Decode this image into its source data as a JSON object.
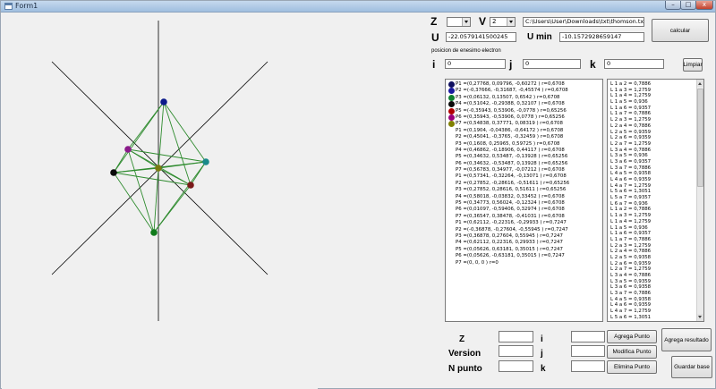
{
  "window": {
    "title": "Form1",
    "controls": {
      "minimize": "–",
      "maximize": "□",
      "close": "x"
    }
  },
  "controls": {
    "z_label": "Z",
    "z_value": "",
    "v_label": "V",
    "v_value": "2",
    "file_path": "C:\\Users\\User\\Downloads\\txt\\thomson.txt",
    "calcular_label": "calcular",
    "u_label": "U",
    "u_value": "-22.0579141500245",
    "umin_label": "U min",
    "umin_value": "-10.1572928659147",
    "posicion_label": "posicion de enesimo electron",
    "i_label": "i",
    "i_value": "0",
    "j_label": "j",
    "j_value": "0",
    "k_label": "k",
    "k_value": "0",
    "limpiar_label": "Limpiar"
  },
  "points": [
    {
      "text": "P1 =(0,27768, 0,09796, -0,60272 ) r=0,6708",
      "color": "#101060"
    },
    {
      "text": "P2 =(-0,37666, -0,31687, -0,45574 ) r=0,6708",
      "color": "#1a1aa0"
    },
    {
      "text": "P3 =(0,06132, 0,13507, 0,6542 ) r=0,6708",
      "color": "#0f8030"
    },
    {
      "text": "P4 =(0,51042, -0,29388, 0,32107 ) r=0,6708",
      "color": "#0a0a0a"
    },
    {
      "text": "P5 =(-0,35943, 0,53906, -0,0778 ) r=0,65256",
      "color": "#b00000"
    },
    {
      "text": "P6 =(0,35943, -0,53906, 0,0778 ) r=0,65256",
      "color": "#9a007a"
    },
    {
      "text": "P7 =(0,54838, 0,37771, 0,08319 ) r=0,6708",
      "color": "#808000"
    },
    {
      "text": "P1 =(0,1904, -0,04386, -0,64172 ) r=0,6708",
      "color": ""
    },
    {
      "text": "P2 =(0,45041, -0,3765, -0,32459 ) r=0,6708",
      "color": ""
    },
    {
      "text": "P3 =(0,1608, 0,25965, 0,59725 ) r=0,6708",
      "color": ""
    },
    {
      "text": "P4 =(0,46862, -0,18906, 0,44117 ) r=0,6708",
      "color": ""
    },
    {
      "text": "P5 =(0,34632, 0,53487, -0,13928 ) r=0,65256",
      "color": ""
    },
    {
      "text": "P6 =(0,34632, -0,53487, 0,13928 ) r=0,65256",
      "color": ""
    },
    {
      "text": "P7 =(0,56783, 0,34977, -0,07212 ) r=0,6708",
      "color": ""
    },
    {
      "text": "P1 =(0,57341, -0,32264, -0,13071 ) r=0,6708",
      "color": ""
    },
    {
      "text": "P2 =(0,27852, -0,28616, -0,51611 ) r=0,65256",
      "color": ""
    },
    {
      "text": "P3 =(0,27852, 0,28616, 0,51611 ) r=0,65256",
      "color": ""
    },
    {
      "text": "P4 =(0,58018, -0,03832, 0,33452 ) r=0,6708",
      "color": ""
    },
    {
      "text": "P5 =(0,34773, 0,56024, -0,12324 ) r=0,6708",
      "color": ""
    },
    {
      "text": "P6 =(0,01097, -0,59406, 0,32974 ) r=0,6708",
      "color": ""
    },
    {
      "text": "P7 =(0,36547, 0,38478, -0,41031 ) r=0,6708",
      "color": ""
    },
    {
      "text": "P1 =(0,62112, -0,22316, -0,29933 ) r=0,7247",
      "color": ""
    },
    {
      "text": "P2 =(-0,36878, -0,27604, -0,55945 ) r=0,7247",
      "color": ""
    },
    {
      "text": "P3 =(0,36878, 0,27604, 0,55945 ) r=0,7247",
      "color": ""
    },
    {
      "text": "P4 =(0,62112, 0,22316, 0,29933 ) r=0,7247",
      "color": ""
    },
    {
      "text": "P5 =(0,05626, 0,63181, 0,35015 ) r=0,7247",
      "color": ""
    },
    {
      "text": "P6 =(0,05626, -0,63181, 0,35015 ) r=0,7247",
      "color": ""
    },
    {
      "text": "P7 =(0, 0, 0 ) r=0",
      "color": ""
    }
  ],
  "distances": [
    "L 1 a 2 = 0,7886",
    "L 1 a 3 = 1,2759",
    "L 1 a 4 = 1,2759",
    "L 1 a 5 = 0,936",
    "L 1 a 6 = 0,9357",
    "L 1 a 7 = 0,7886",
    "L 2 a 3 = 1,2759",
    "L 2 a 4 = 0,7886",
    "L 2 a 5 = 0,9359",
    "L 2 a 6 = 0,9359",
    "L 2 a 7 = 1,2759",
    "L 3 a 4 = 0,7886",
    "L 3 a 5 = 0,936",
    "L 3 a 6 = 0,9357",
    "L 3 a 7 = 0,7886",
    "L 4 a 5 = 0,9358",
    "L 4 a 6 = 0,9359",
    "L 4 a 7 = 1,2759",
    "L 5 a 6 = 1,3051",
    "L 5 a 7 = 0,9357",
    "L 6 a 7 = 0,936",
    "L 1 a 2 = 0,7886",
    "L 1 a 3 = 1,2759",
    "L 1 a 4 = 1,2759",
    "L 1 a 5 = 0,936",
    "L 1 a 6 = 0,9357",
    "L 1 a 7 = 0,7886",
    "L 2 a 3 = 1,2759",
    "L 2 a 4 = 0,7886",
    "L 2 a 5 = 0,9358",
    "L 2 a 6 = 0,9359",
    "L 2 a 7 = 1,2759",
    "L 3 a 4 = 0,7886",
    "L 3 a 5 = 0,9359",
    "L 3 a 6 = 0,9358",
    "L 3 a 7 = 0,7886",
    "L 4 a 5 = 0,9358",
    "L 4 a 6 = 0,9359",
    "L 4 a 7 = 1,2759",
    "L 5 a 6 = 1,3051"
  ],
  "bottom": {
    "z_label": "Z",
    "version_label": "Version",
    "npunto_label": "N punto",
    "i_label": "i",
    "j_label": "j",
    "k_label": "k",
    "agrega_punto": "Agrega Punto",
    "modifica_punto": "Modifica Punto",
    "elimina_punto": "Elimina Punto",
    "agrega_resultado": "Agrega resultado",
    "guardar_base": "Guardar base"
  },
  "colors": {
    "edge": "#2e8b2e",
    "axis": "#000000",
    "nodes": [
      "#0b1a8a",
      "#8a1a8a",
      "#0a0a0a",
      "#1a8a8a",
      "#7a1a1a",
      "#0f7a1a",
      "#7a7a10"
    ]
  }
}
